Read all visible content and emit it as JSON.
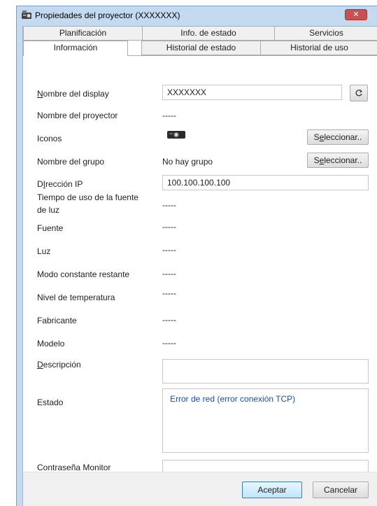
{
  "window": {
    "title": "Propiedades del proyector (XXXXXXX)",
    "close_symbol": "✕"
  },
  "tabs": {
    "row1": [
      "Planificación",
      "Info. de estado",
      "Servicios"
    ],
    "row2": [
      "Información",
      "Historial de estado",
      "Historial de uso"
    ],
    "active": "Información"
  },
  "form": {
    "display_name": {
      "label_pre": "",
      "label_u": "N",
      "label_post": "ombre del display",
      "value": "XXXXXXX",
      "refresh_icon": "refresh-icon"
    },
    "projector_name": {
      "label": "Nombre del proyector",
      "value": "-----"
    },
    "icons": {
      "label": "Iconos",
      "icon": "projector-icon",
      "button_pre": "S",
      "button_u": "e",
      "button_post": "leccionar.."
    },
    "group_name": {
      "label": "Nombre del grupo",
      "value": "No hay grupo",
      "button_pre": "S",
      "button_u": "e",
      "button_post": "leccionar.."
    },
    "ip_address": {
      "label_pre": "D",
      "label_u": "I",
      "label_post": "rección IP",
      "value": "100.100.100.100"
    },
    "light_time": {
      "label": "Tiempo de uso de la fuente de luz",
      "value": "-----"
    },
    "source": {
      "label": "Fuente",
      "value": "-----"
    },
    "light": {
      "label": "Luz",
      "value": "-----"
    },
    "constant_mode": {
      "label": "Modo constante restante",
      "value": "-----"
    },
    "temperature": {
      "label": "Nivel de temperatura",
      "value": "-----"
    },
    "manufacturer": {
      "label": "Fabricante",
      "value": "-----"
    },
    "model": {
      "label": "Modelo",
      "value": "-----"
    },
    "description": {
      "label_pre": "",
      "label_u": "D",
      "label_post": "escripción",
      "value": ""
    },
    "status": {
      "label": "Estado",
      "value": "Error de red (error conexión TCP)",
      "color": "#1a4fa0"
    },
    "monitor_password": {
      "label": "Contraseña Monitor",
      "value": ""
    }
  },
  "footer": {
    "ok_label": "Aceptar",
    "cancel_label": "Cancelar"
  }
}
